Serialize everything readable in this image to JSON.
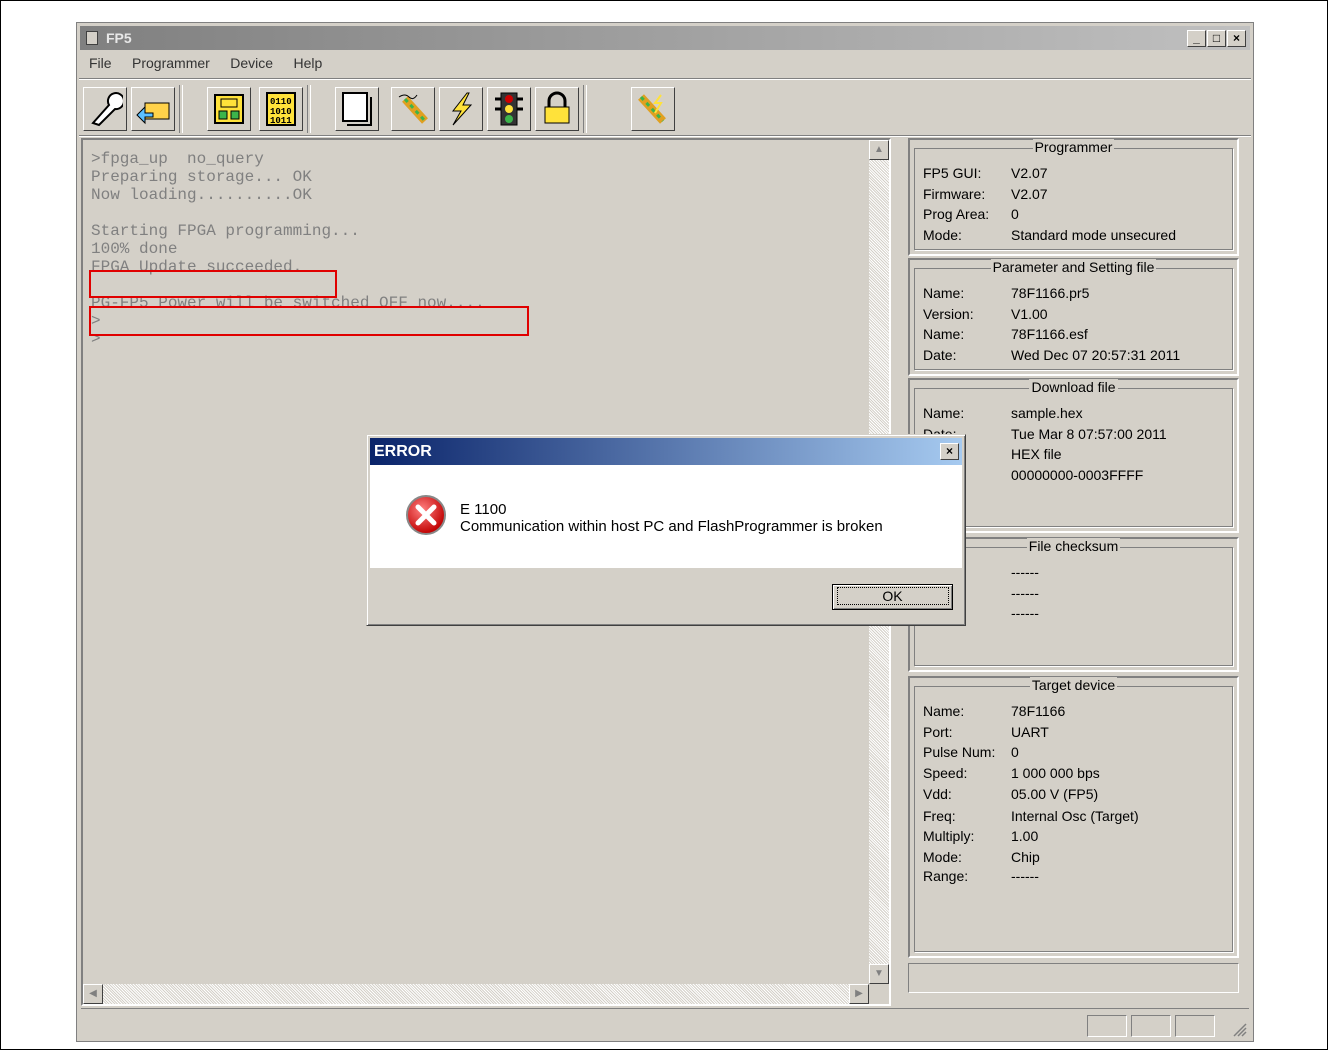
{
  "window": {
    "title": "FP5"
  },
  "menu": [
    "File",
    "Programmer",
    "Device",
    "Help"
  ],
  "toolbar": {
    "buttons": [
      "setup-wrench-icon",
      "open-folder-icon",
      "chip-layout-icon",
      "binary-data-icon",
      "blank-page-icon",
      "erase-pen-icon",
      "program-lightning-icon",
      "traffic-light-icon",
      "security-lock-icon",
      "autoprocedure-pen-icon"
    ]
  },
  "log": {
    "lines": [
      ">fpga_up  no_query",
      "Preparing storage... OK",
      "Now loading..........OK",
      "",
      "Starting FPGA programming...",
      "100% done",
      "FPGA Update succeeded.",
      "",
      "PG-FP5 Power will be switched OFF now....",
      ">",
      ">"
    ]
  },
  "programmer": {
    "title": "Programmer",
    "rows": [
      {
        "k": "FP5 GUI:",
        "v": "V2.07"
      },
      {
        "k": "Firmware:",
        "v": "V2.07"
      },
      {
        "k": "Prog Area:",
        "v": "0"
      },
      {
        "k": "Mode:",
        "v": "Standard mode unsecured"
      }
    ]
  },
  "param": {
    "title": "Parameter and Setting file",
    "rows": [
      {
        "k": "Name:",
        "v": "78F1166.pr5"
      },
      {
        "k": "Version:",
        "v": "V1.00"
      },
      {
        "k": "Name:",
        "v": "78F1166.esf"
      },
      {
        "k": "Date:",
        "v": "Wed Dec 07 20:57:31 2011"
      }
    ]
  },
  "download": {
    "title": "Download file",
    "rows": [
      {
        "k": "Name:",
        "v": "sample.hex"
      },
      {
        "k": "Date:",
        "v": "Tue Mar  8 07:57:00 2011"
      },
      {
        "k": "",
        "v": "HEX file"
      },
      {
        "k": ":",
        "v": "00000000-0003FFFF"
      }
    ]
  },
  "checksum": {
    "title": "File checksum",
    "rows": [
      {
        "k": "",
        "v": "------"
      },
      {
        "k": ":",
        "v": "------"
      },
      {
        "k": "",
        "v": "------"
      }
    ]
  },
  "target": {
    "title": "Target device",
    "rows": [
      {
        "k": "Name:",
        "v": "78F1166"
      },
      {
        "k": "Port:",
        "v": "UART"
      },
      {
        "k": "Pulse Num:",
        "v": "0"
      },
      {
        "k": "Speed:",
        "v": "1 000 000 bps"
      },
      {
        "k": "Vdd:",
        "v": "05.00 V (FP5)"
      },
      {
        "k": "Freq:",
        "v": "Internal Osc (Target)"
      },
      {
        "k": "Multiply:",
        "v": "1.00"
      },
      {
        "k": "Mode:",
        "v": "Chip"
      },
      {
        "k": "Range:",
        "v": "------"
      }
    ]
  },
  "dialog": {
    "title": "ERROR",
    "code": "E 1100",
    "message": "Communication within host PC and FlashProgrammer is broken",
    "ok": "OK",
    "icon": "error-x-icon"
  },
  "colors": {
    "highlight": "#e00000",
    "dialog_title": "#0a246a"
  }
}
